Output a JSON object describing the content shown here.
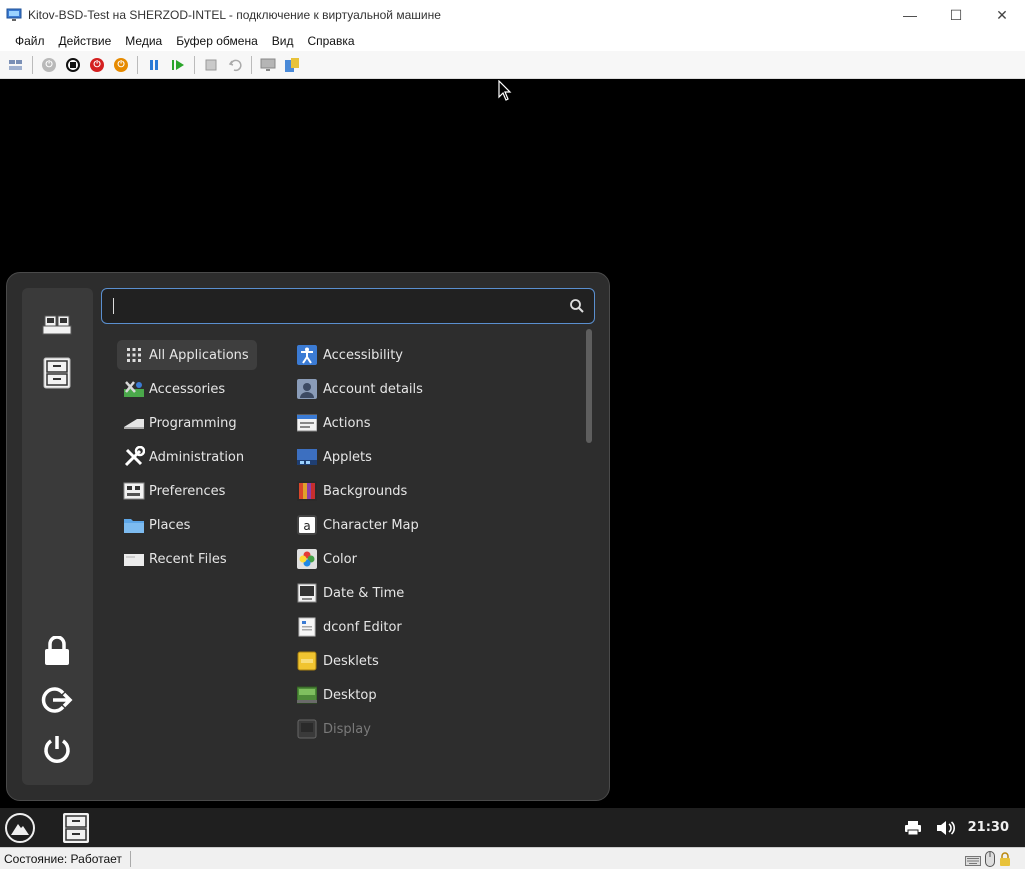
{
  "window": {
    "title": "Kitov-BSD-Test на SHERZOD-INTEL - подключение к виртуальной машине",
    "controls": {
      "minimize": "—",
      "maximize": "☐",
      "close": "✕"
    }
  },
  "menubar": {
    "items": [
      "Файл",
      "Действие",
      "Медиа",
      "Буфер обмена",
      "Вид",
      "Справка"
    ]
  },
  "toolbar": {
    "icons": [
      "ctrl-alt-del-icon",
      "start-icon",
      "turn-off-icon",
      "shutdown-icon",
      "save-icon",
      "pause-icon",
      "resume-icon",
      "checkpoint-icon",
      "revert-icon",
      "enhanced-session-icon",
      "share-icon"
    ]
  },
  "app_menu": {
    "search": {
      "value": "",
      "placeholder": ""
    },
    "categories": [
      {
        "label": "All Applications",
        "icon": "grid-icon",
        "selected": true
      },
      {
        "label": "Accessories",
        "icon": "accessories-icon"
      },
      {
        "label": "Programming",
        "icon": "programming-icon"
      },
      {
        "label": "Administration",
        "icon": "administration-icon"
      },
      {
        "label": "Preferences",
        "icon": "preferences-icon"
      },
      {
        "label": "Places",
        "icon": "folder-icon"
      },
      {
        "label": "Recent Files",
        "icon": "recent-files-icon"
      }
    ],
    "apps": [
      {
        "label": "Accessibility",
        "icon": "accessibility-icon"
      },
      {
        "label": "Account details",
        "icon": "account-icon"
      },
      {
        "label": "Actions",
        "icon": "actions-icon"
      },
      {
        "label": "Applets",
        "icon": "applets-icon"
      },
      {
        "label": "Backgrounds",
        "icon": "backgrounds-icon"
      },
      {
        "label": "Character Map",
        "icon": "character-map-icon"
      },
      {
        "label": "Color",
        "icon": "color-icon"
      },
      {
        "label": "Date & Time",
        "icon": "date-time-icon"
      },
      {
        "label": "dconf Editor",
        "icon": "dconf-icon"
      },
      {
        "label": "Desklets",
        "icon": "desklets-icon"
      },
      {
        "label": "Desktop",
        "icon": "desktop-icon"
      },
      {
        "label": "Display",
        "icon": "display-icon",
        "dimmed": true
      }
    ],
    "sidebar": [
      "computer-icon",
      "file-cabinet-icon",
      "lock-icon",
      "logout-icon",
      "power-icon"
    ]
  },
  "taskbar": {
    "clock": "21:30"
  },
  "statusbar": {
    "text": "Состояние: Работает"
  },
  "colors": {
    "menu_bg": "#2d2d2d",
    "sidebar_bg": "#3a3a3a",
    "search_border": "#5a8fcf",
    "taskbar_bg": "#1f1f1f"
  }
}
